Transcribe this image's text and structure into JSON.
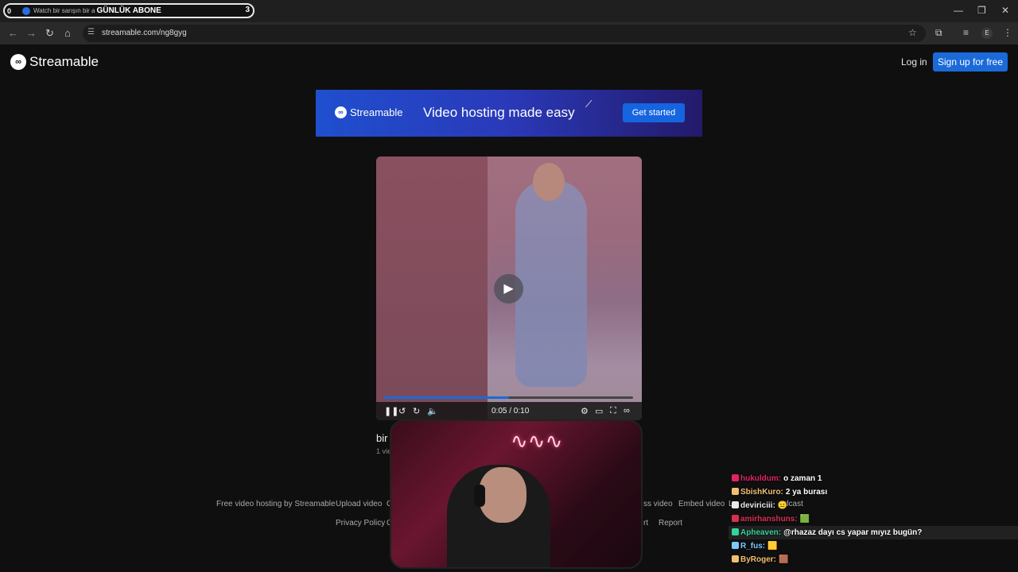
{
  "browser": {
    "overlay_left": "0",
    "tab_title": "Watch bir sarışın bir a",
    "overlay_title": "GÜNLÜK ABONE",
    "overlay_count": "3",
    "url": "streamable.com/ng8gyg",
    "profile_initial": "E",
    "controls": {
      "minimize": "—",
      "restore": "❐",
      "close": "✕"
    }
  },
  "header": {
    "logo_text": "Streamable",
    "login": "Log in",
    "signup": "Sign up for free"
  },
  "banner": {
    "brand": "Streamable",
    "tagline": "Video hosting made easy",
    "cta": "Get started"
  },
  "video": {
    "time": "0:05 / 0:10",
    "progress": 0.5,
    "title_fragment": "bir",
    "views_fragment": "1 vie"
  },
  "footer": {
    "row1": [
      "Free video hosting by Streamable",
      "Upload video",
      "C",
      "ss video",
      "Embed video",
      "L",
      "dcast"
    ],
    "row2": [
      "Privacy Policy",
      "C",
      "rt",
      "Report"
    ]
  },
  "chat": [
    {
      "user": "hukuldum:",
      "msg": "o zaman 1",
      "color": "#e0245e"
    },
    {
      "user": "SbishKuro:",
      "msg": "2 ya burası",
      "color": "#f0c070"
    },
    {
      "user": "deviriciii:",
      "msg": "😐",
      "color": "#e8e8e8"
    },
    {
      "user": "amirhanshuns:",
      "msg": "🟩",
      "color": "#d6304f"
    },
    {
      "user": "Apheaven:",
      "msg": "@rhazaz dayı cs yapar mıyız bugün?",
      "color": "#35d39a"
    },
    {
      "user": "R_fus:",
      "msg": "🟨",
      "color": "#7ec8ff"
    },
    {
      "user": "ByRoger:",
      "msg": "🟫",
      "color": "#f0c070"
    }
  ],
  "colors": {
    "accent": "#1a6ad9",
    "page_bg": "#0f0f10"
  }
}
